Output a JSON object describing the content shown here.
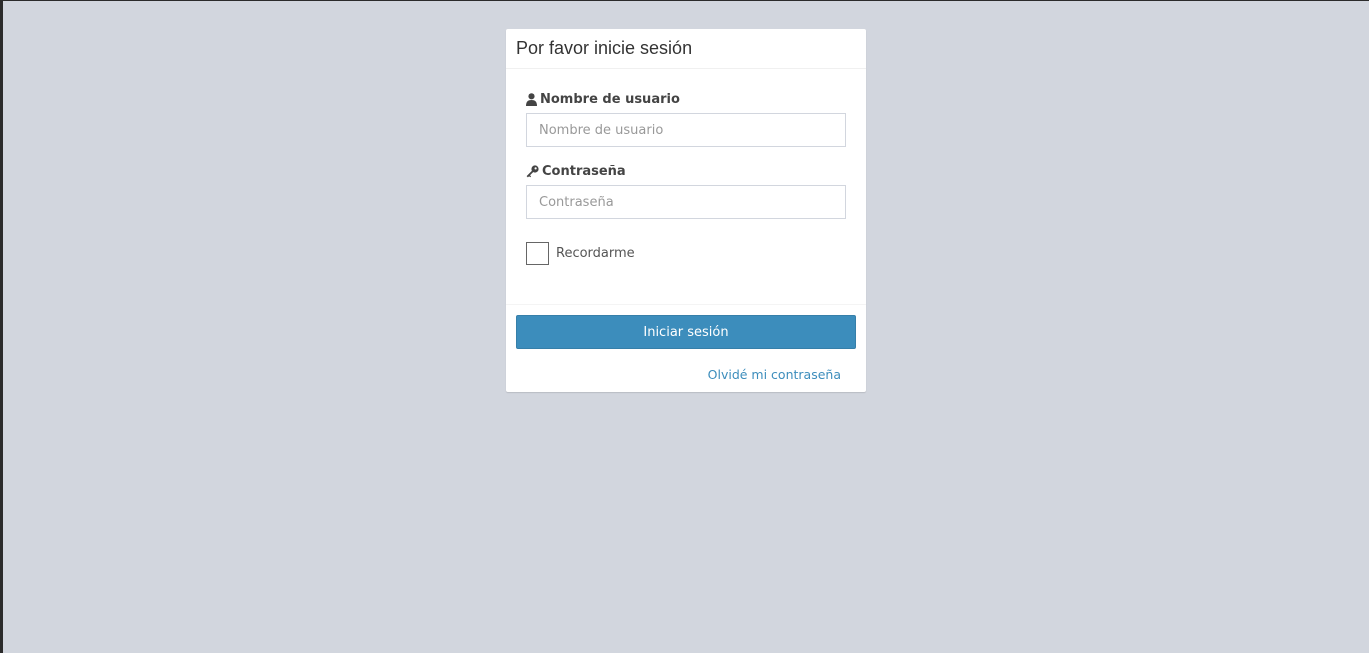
{
  "panel": {
    "title": "Por favor inicie sesión"
  },
  "username": {
    "label": "Nombre de usuario",
    "icon": "user-icon",
    "placeholder": "Nombre de usuario",
    "value": ""
  },
  "password": {
    "label": "Contraseña",
    "icon": "key-icon",
    "placeholder": "Contraseña",
    "value": ""
  },
  "remember": {
    "label": "Recordarme",
    "checked": false
  },
  "actions": {
    "submit_label": "Iniciar sesión",
    "forgot_label": "Olvidé mi contraseña"
  },
  "colors": {
    "background": "#d2d6de",
    "primary": "#3c8dbc",
    "panel": "#ffffff"
  }
}
